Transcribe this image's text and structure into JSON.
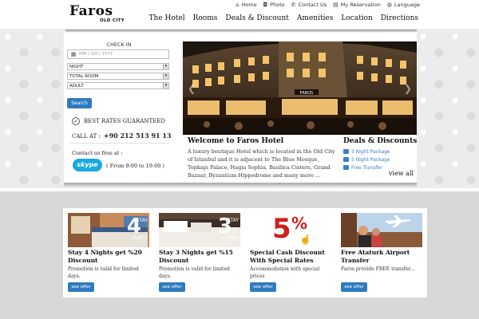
{
  "header": {
    "logo_main": "Faros",
    "logo_sub": "OLD CITY",
    "toplinks": [
      {
        "icon": "home-icon",
        "glyph": "⌂",
        "label": "Home"
      },
      {
        "icon": "camera-icon",
        "glyph": "◘",
        "label": "Photo"
      },
      {
        "icon": "phone-icon",
        "glyph": "✆",
        "label": "Contact Us"
      },
      {
        "icon": "calendar-icon",
        "glyph": "▤",
        "label": "My Reservation"
      },
      {
        "icon": "globe-icon",
        "glyph": "◍",
        "label": "Language"
      }
    ],
    "nav": [
      "The Hotel",
      "Rooms",
      "Deals & Discount",
      "Amenities",
      "Location",
      "Directions"
    ]
  },
  "booking": {
    "checkin_label": "CHECK IN",
    "date_placeholder": "MM / DD / YYYY",
    "night": "NIGHT",
    "total_room": "TOTAL ROOM",
    "adult": "ADULT",
    "search": "Search",
    "best_rates": "BEST RATES GUARANTEED",
    "call_at": "CALL AT :",
    "phone": "+90 212 513 91 13",
    "contact_free": "Contact us free at :",
    "skype_label": "skype",
    "skype_hours": "( From 9:00 to 19:00 )"
  },
  "hero": {
    "hotel_sign": "FAROS",
    "welcome_title": "Welcome to Faros Hotel",
    "welcome_text": "A luxury boutique Hotel which is located in the Old City of Istanbul and it is adjacent to The Blue Mosque, Topkapı Palace, Hagia Sophia, Basilica Cistern, Grand Bazaar, Byzantium Hippodrome and many more ...",
    "deals_title": "Deals & Discounts",
    "deals": [
      "3 Night Package",
      "5 Night Package",
      "Free Transfer"
    ],
    "view_all": "view all"
  },
  "cards": [
    {
      "title": "Stay 4 Nights get %20 Discount",
      "desc": "Promotion is valid for limited days.",
      "button": "see offer",
      "badge_num": "4",
      "badge_word": "STAY",
      "badge_sub": "nights"
    },
    {
      "title": "Stay 3 Nights get %15 Discount",
      "desc": "Promotion is valid for limited days.",
      "button": "see offer",
      "badge_num": "3",
      "badge_word": "STAY",
      "badge_sub": "nights"
    },
    {
      "title": "Special Cash Discount With Special Rates",
      "desc": "Accommodation with special prices",
      "button": "see offer",
      "badge_num": "5",
      "badge_pct": "%"
    },
    {
      "title": "Free Ataturk Airport Transfer",
      "desc": "Faros provide FREE transfer...",
      "button": "see offer"
    }
  ]
}
